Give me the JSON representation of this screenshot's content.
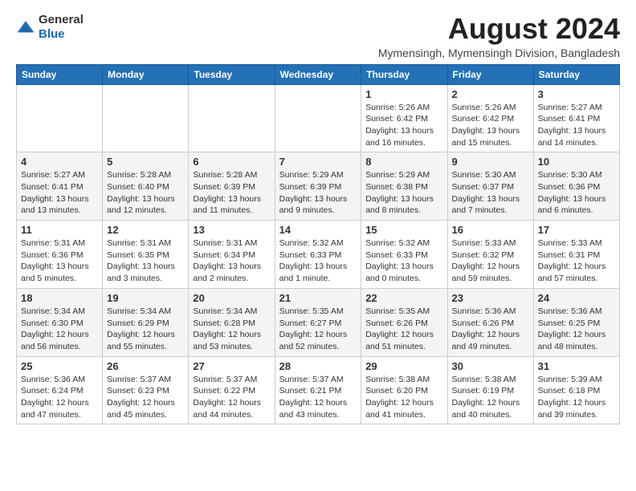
{
  "logo": {
    "text_general": "General",
    "text_blue": "Blue"
  },
  "title": "August 2024",
  "subtitle": "Mymensingh, Mymensingh Division, Bangladesh",
  "headers": [
    "Sunday",
    "Monday",
    "Tuesday",
    "Wednesday",
    "Thursday",
    "Friday",
    "Saturday"
  ],
  "weeks": [
    [
      {
        "day": "",
        "info": ""
      },
      {
        "day": "",
        "info": ""
      },
      {
        "day": "",
        "info": ""
      },
      {
        "day": "",
        "info": ""
      },
      {
        "day": "1",
        "info": "Sunrise: 5:26 AM\nSunset: 6:42 PM\nDaylight: 13 hours\nand 16 minutes."
      },
      {
        "day": "2",
        "info": "Sunrise: 5:26 AM\nSunset: 6:42 PM\nDaylight: 13 hours\nand 15 minutes."
      },
      {
        "day": "3",
        "info": "Sunrise: 5:27 AM\nSunset: 6:41 PM\nDaylight: 13 hours\nand 14 minutes."
      }
    ],
    [
      {
        "day": "4",
        "info": "Sunrise: 5:27 AM\nSunset: 6:41 PM\nDaylight: 13 hours\nand 13 minutes."
      },
      {
        "day": "5",
        "info": "Sunrise: 5:28 AM\nSunset: 6:40 PM\nDaylight: 13 hours\nand 12 minutes."
      },
      {
        "day": "6",
        "info": "Sunrise: 5:28 AM\nSunset: 6:39 PM\nDaylight: 13 hours\nand 11 minutes."
      },
      {
        "day": "7",
        "info": "Sunrise: 5:29 AM\nSunset: 6:39 PM\nDaylight: 13 hours\nand 9 minutes."
      },
      {
        "day": "8",
        "info": "Sunrise: 5:29 AM\nSunset: 6:38 PM\nDaylight: 13 hours\nand 8 minutes."
      },
      {
        "day": "9",
        "info": "Sunrise: 5:30 AM\nSunset: 6:37 PM\nDaylight: 13 hours\nand 7 minutes."
      },
      {
        "day": "10",
        "info": "Sunrise: 5:30 AM\nSunset: 6:36 PM\nDaylight: 13 hours\nand 6 minutes."
      }
    ],
    [
      {
        "day": "11",
        "info": "Sunrise: 5:31 AM\nSunset: 6:36 PM\nDaylight: 13 hours\nand 5 minutes."
      },
      {
        "day": "12",
        "info": "Sunrise: 5:31 AM\nSunset: 6:35 PM\nDaylight: 13 hours\nand 3 minutes."
      },
      {
        "day": "13",
        "info": "Sunrise: 5:31 AM\nSunset: 6:34 PM\nDaylight: 13 hours\nand 2 minutes."
      },
      {
        "day": "14",
        "info": "Sunrise: 5:32 AM\nSunset: 6:33 PM\nDaylight: 13 hours\nand 1 minute."
      },
      {
        "day": "15",
        "info": "Sunrise: 5:32 AM\nSunset: 6:33 PM\nDaylight: 13 hours\nand 0 minutes."
      },
      {
        "day": "16",
        "info": "Sunrise: 5:33 AM\nSunset: 6:32 PM\nDaylight: 12 hours\nand 59 minutes."
      },
      {
        "day": "17",
        "info": "Sunrise: 5:33 AM\nSunset: 6:31 PM\nDaylight: 12 hours\nand 57 minutes."
      }
    ],
    [
      {
        "day": "18",
        "info": "Sunrise: 5:34 AM\nSunset: 6:30 PM\nDaylight: 12 hours\nand 56 minutes."
      },
      {
        "day": "19",
        "info": "Sunrise: 5:34 AM\nSunset: 6:29 PM\nDaylight: 12 hours\nand 55 minutes."
      },
      {
        "day": "20",
        "info": "Sunrise: 5:34 AM\nSunset: 6:28 PM\nDaylight: 12 hours\nand 53 minutes."
      },
      {
        "day": "21",
        "info": "Sunrise: 5:35 AM\nSunset: 6:27 PM\nDaylight: 12 hours\nand 52 minutes."
      },
      {
        "day": "22",
        "info": "Sunrise: 5:35 AM\nSunset: 6:26 PM\nDaylight: 12 hours\nand 51 minutes."
      },
      {
        "day": "23",
        "info": "Sunrise: 5:36 AM\nSunset: 6:26 PM\nDaylight: 12 hours\nand 49 minutes."
      },
      {
        "day": "24",
        "info": "Sunrise: 5:36 AM\nSunset: 6:25 PM\nDaylight: 12 hours\nand 48 minutes."
      }
    ],
    [
      {
        "day": "25",
        "info": "Sunrise: 5:36 AM\nSunset: 6:24 PM\nDaylight: 12 hours\nand 47 minutes."
      },
      {
        "day": "26",
        "info": "Sunrise: 5:37 AM\nSunset: 6:23 PM\nDaylight: 12 hours\nand 45 minutes."
      },
      {
        "day": "27",
        "info": "Sunrise: 5:37 AM\nSunset: 6:22 PM\nDaylight: 12 hours\nand 44 minutes."
      },
      {
        "day": "28",
        "info": "Sunrise: 5:37 AM\nSunset: 6:21 PM\nDaylight: 12 hours\nand 43 minutes."
      },
      {
        "day": "29",
        "info": "Sunrise: 5:38 AM\nSunset: 6:20 PM\nDaylight: 12 hours\nand 41 minutes."
      },
      {
        "day": "30",
        "info": "Sunrise: 5:38 AM\nSunset: 6:19 PM\nDaylight: 12 hours\nand 40 minutes."
      },
      {
        "day": "31",
        "info": "Sunrise: 5:39 AM\nSunset: 6:18 PM\nDaylight: 12 hours\nand 39 minutes."
      }
    ]
  ]
}
